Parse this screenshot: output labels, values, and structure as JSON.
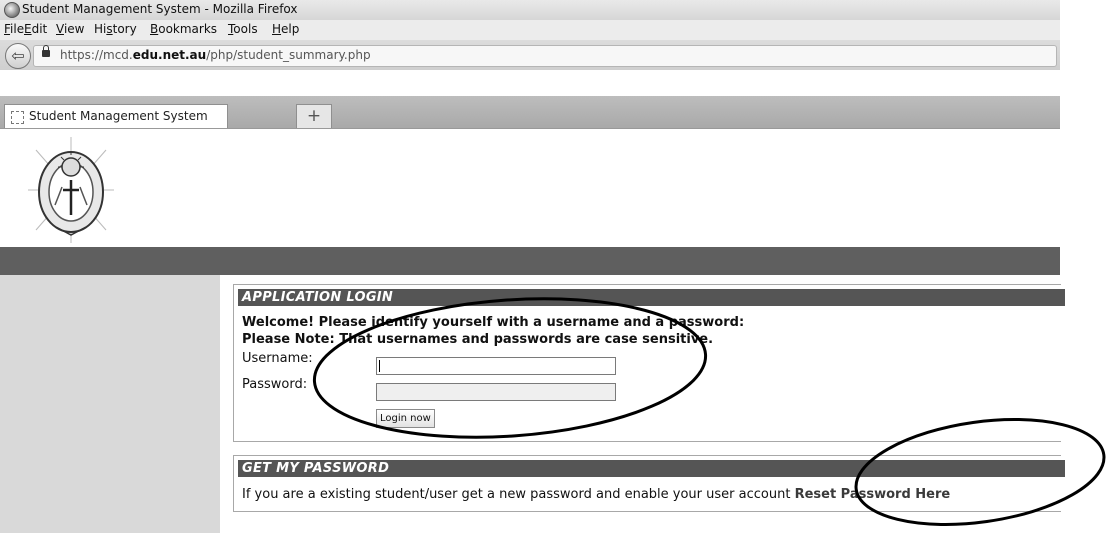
{
  "window": {
    "title": "Student Management System - Mozilla Firefox"
  },
  "menu": [
    {
      "pre": "",
      "key": "F",
      "post": "ile"
    },
    {
      "pre": "",
      "key": "E",
      "post": "dit"
    },
    {
      "pre": "",
      "key": "V",
      "post": "iew"
    },
    {
      "pre": "Hi",
      "key": "s",
      "post": "tory"
    },
    {
      "pre": "",
      "key": "B",
      "post": "ookmarks"
    },
    {
      "pre": "",
      "key": "T",
      "post": "ools"
    },
    {
      "pre": "",
      "key": "H",
      "post": "elp"
    }
  ],
  "address": {
    "prefix": "https://mcd.",
    "domain": "edu.net.au",
    "path": "/php/student_summary.php"
  },
  "tab": {
    "title": "Student Management System",
    "new_tab": "+"
  },
  "login": {
    "header": "APPLICATION LOGIN",
    "welcome": "Welcome! Please identify yourself with a username and a password:",
    "note": "Please Note: That usernames and passwords are case sensitive.",
    "username_label": "Username:",
    "password_label": "Password:",
    "username_value": "",
    "password_value": "",
    "button": "Login now"
  },
  "password_section": {
    "header": "GET MY PASSWORD",
    "text": "If you are a existing student/user get a new password and enable your user account",
    "link": "Reset Password Here"
  },
  "icons": [
    "firefox-icon",
    "back-arrow-icon",
    "lock-icon",
    "page-favicon",
    "plus-icon",
    "school-seal-logo"
  ],
  "colors": {
    "header_bar": "#555555",
    "dark_bar": "#5f5f5f",
    "sidebar": "#d9d9d9"
  }
}
